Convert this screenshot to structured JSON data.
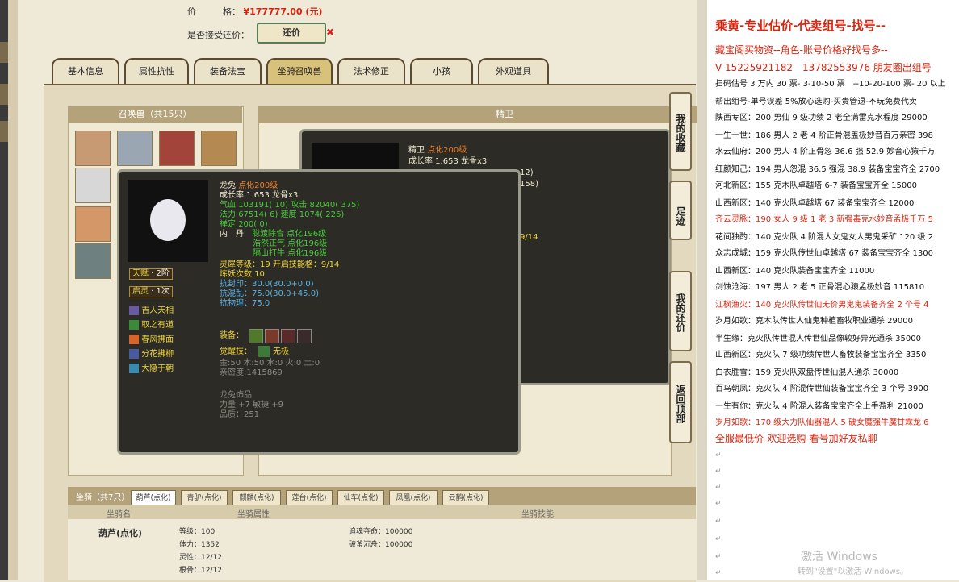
{
  "top": {
    "price_label": "价　　　格：",
    "price_value": "¥177777.00 (元)",
    "counter_label": "是否接受还价：",
    "counter_button": "还价",
    "counter_x": "✖"
  },
  "tabs": [
    "基本信息",
    "属性抗性",
    "装备法宝",
    "坐骑召唤兽",
    "法术修正",
    "小孩",
    "外观道具"
  ],
  "active_tab": "坐骑召唤兽",
  "summon": {
    "header": "召唤兽（共15只）",
    "detail_header": "精卫"
  },
  "tip_back": {
    "name": "精卫",
    "tag": "点化200级",
    "growth": "成长率 1.653 龙骨x3",
    "n1": "12)",
    "n2": "158)",
    "n3": "9/14"
  },
  "tip_front": {
    "name": "龙兔",
    "tag": "点化200级",
    "growth": "成长率 1.653 龙骨x3",
    "hp_label": "气血",
    "hp": "103191( 10)",
    "atk_label": "攻击",
    "atk": "82040( 375)",
    "mp_label": "法力",
    "mp": "67514( 6)",
    "spd_label": "速度",
    "spd": "1074( 226)",
    "zen_label": "禅定",
    "zen": "200( 0)",
    "dan_label": "内　丹",
    "dan1": "聪渡除合 点化196级",
    "dan2": "浩然正气 点化196级",
    "dan3": "隔山打牛 点化196级",
    "lx_label": "灵犀等级：",
    "lx": "19 开启技能格：9/14",
    "lianyao": "炼妖次数 10",
    "res1_label": "抗封印：",
    "res1": "30.0(30.0+0.0)",
    "res2_label": "抗混乱：",
    "res2": "75.0(30.0+45.0)",
    "res3_label": "抗物理：",
    "res3": "75.0",
    "equip_label": "装备：",
    "awake_label": "觉醒技：",
    "awake": "无极",
    "elements": "金:50 木:50 水:0 火:0 土:0",
    "intimacy": "亲密度:1415869",
    "acc_title": "龙兔饰品",
    "acc1": "力量 +7 敏捷 +9",
    "acc2": "品质：251"
  },
  "side_tags": [
    {
      "label": "天赋",
      "value": "2阶"
    },
    {
      "label": "启灵",
      "value": "1次"
    }
  ],
  "side_skills": [
    "吉人天相",
    "取之有道",
    "春风拂面",
    "分花拂柳",
    "大隐于朝"
  ],
  "side_buttons": [
    "我的收藏",
    "足迹",
    "我的还价",
    "返回顶部"
  ],
  "mount": {
    "header": "坐骑（共7只）",
    "tabs": [
      "葫芦(点化)",
      "青驴(点化)",
      "麒麟(点化)",
      "莲台(点化)",
      "仙车(点化)",
      "凤凰(点化)",
      "云鹤(点化)"
    ],
    "col1": "坐骑名",
    "col2": "坐骑属性",
    "col3": "坐骑技能",
    "name": "葫芦(点化)",
    "attrs": [
      "等级：100",
      "体力：1352",
      "灵性：12/12",
      "根骨：12/12"
    ],
    "skills": [
      "追魂夺命：100000",
      "破釜沉舟：100000"
    ]
  },
  "doc": {
    "title": "乘黄-专业估价-代卖组号-找号--",
    "line2": "藏宝阁买物资--角色-账号价格好找号多--",
    "line3": "V 15225921182　13782553976 朋友圈出组号",
    "lines": [
      {
        "t": "扫码估号 3 万内 30 票- 3-10-50 票　--10-20-100 票- 20 以上",
        "c": "k"
      },
      {
        "t": "帮出组号-单号误差 5%放心选购-买贵管退-不玩免费代卖",
        "c": "k"
      },
      {
        "t": "陕西专区：200 男仙 9 级功绩 2 老全满雷克水程度 29000",
        "c": "k"
      },
      {
        "t": "一生一世：186 男人 2 老 4 阶正骨混盖极妙音百万亲密 398",
        "c": "k"
      },
      {
        "t": "水云仙府：200 男人 4 阶正骨忽 36.6 强 52.9 妙音心猿千万",
        "c": "k"
      },
      {
        "t": "红颜知己：194 男人忽混 36.5 强混 38.9 装备宝宝齐全 2700",
        "c": "k"
      },
      {
        "t": "河北新区：155 克木队卓越塔 6-7 装备宝宝齐全 15000",
        "c": "k"
      },
      {
        "t": "山西新区：140 克火队卓越塔 67 装备宝宝齐全 12000",
        "c": "k"
      },
      {
        "t": "齐云灵脉：190 女人 9 级 1 老 3 新强毒克水妙音孟极千万 5",
        "c": "r"
      },
      {
        "t": "花间独酌：140 克火队 4 阶混人女鬼女人男鬼采矿 120 级 2",
        "c": "k"
      },
      {
        "t": "众志成城：159 克火队传世仙卓越塔 67 装备宝宝齐全 1300",
        "c": "k"
      },
      {
        "t": "山西新区：140 克火队装备宝宝齐全 11000",
        "c": "k"
      },
      {
        "t": "剑蚀沧海：197 男人 2 老 5 正骨混心猿孟极妙音 115810",
        "c": "k"
      },
      {
        "t": "江枫渔火：140 克火队传世仙无价男鬼鬼装备齐全 2 个号 4",
        "c": "r"
      },
      {
        "t": "岁月如歌：克木队传世人仙鬼种植畜牧职业通杀 29000",
        "c": "k"
      },
      {
        "t": "半生缘：克火队传世混人传世仙品像较好异光通杀 35000",
        "c": "k"
      },
      {
        "t": "山西新区：克火队 7 级功绩传世人畜牧装备宝宝齐全 3350",
        "c": "k"
      },
      {
        "t": "白衣胜雪：159 克火队双盘传世仙混人通杀 30000",
        "c": "k"
      },
      {
        "t": "百鸟朝凤：克火队 4 阶混传世仙装备宝宝齐全 3 个号 3900",
        "c": "k"
      },
      {
        "t": "一生有你：克火队 4 阶混人装备宝宝齐全上手盈利 21000",
        "c": "k"
      },
      {
        "t": "岁月如歌：170 级大力队仙器混人 5 破女魔强牛魔甘霖龙 6",
        "c": "r"
      },
      {
        "t": "全服最低价-欢迎选购-看号加好友私聊",
        "c": "r"
      }
    ],
    "return_mark": "↵",
    "watermark1": "激活 Windows",
    "watermark2": "转到\"设置\"以激活 Windows。"
  }
}
